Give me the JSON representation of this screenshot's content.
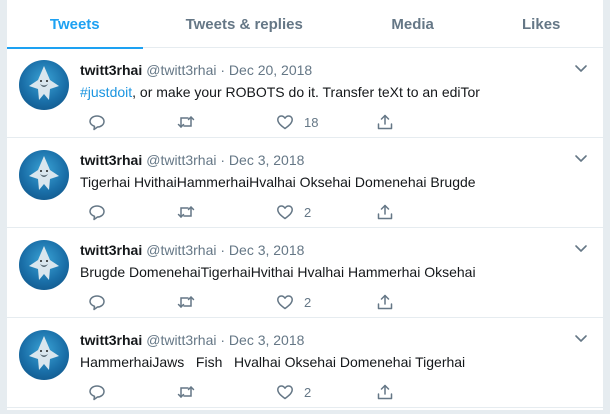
{
  "tabs": [
    {
      "label": "Tweets",
      "active": true
    },
    {
      "label": "Tweets & replies",
      "active": false
    },
    {
      "label": "Media",
      "active": false
    },
    {
      "label": "Likes",
      "active": false
    }
  ],
  "colors": {
    "accent": "#1da1f2",
    "muted": "#657786",
    "text": "#14171a"
  },
  "tweets": [
    {
      "name": "twitt3rhai",
      "handle": "@twitt3rhai",
      "sep": "·",
      "date": "Dec 20, 2018",
      "hashtag": "#justdoit",
      "text": ", or make your ROBOTS do it. Transfer teXt to an ediTor",
      "likes": "18"
    },
    {
      "name": "twitt3rhai",
      "handle": "@twitt3rhai",
      "sep": "·",
      "date": "Dec 3, 2018",
      "hashtag": "",
      "text": "Tigerhai HvithaiHammerhaiHvalhai Oksehai Domenehai Brugde",
      "likes": "2"
    },
    {
      "name": "twitt3rhai",
      "handle": "@twitt3rhai",
      "sep": "·",
      "date": "Dec 3, 2018",
      "hashtag": "",
      "text": "Brugde DomenehaiTigerhaiHvithai Hvalhai Hammerhai Oksehai",
      "likes": "2"
    },
    {
      "name": "twitt3rhai",
      "handle": "@twitt3rhai",
      "sep": "·",
      "date": "Dec 3, 2018",
      "hashtag": "",
      "text": "HammerhaiJaws   Fish   Hvalhai Oksehai Domenehai Tigerhai",
      "likes": "2"
    }
  ],
  "icons": {
    "avatar": "shark-avatar",
    "caret": "chevron-down-icon",
    "reply": "reply-icon",
    "retweet": "retweet-icon",
    "like": "heart-icon",
    "share": "share-icon"
  }
}
